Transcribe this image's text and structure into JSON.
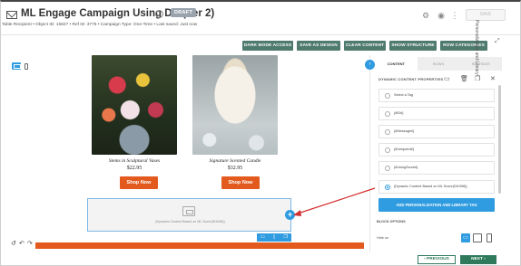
{
  "header": {
    "title": "ML Engage Campaign Using DC (Ver 2)",
    "status_badge": "DRAFT",
    "meta": "Table Recipient  •  Object ID: 15827  •  Ref ID: 3775  •  Campaign Type: One-Time  •  Last saved: Just now",
    "save_label": "SAVE",
    "icons": [
      "info-icon",
      "settings-icon",
      "preview-icon",
      "more-icon"
    ]
  },
  "toolbar": {
    "buttons": [
      "DARK MODE ACCESS",
      "SAVE AS DESIGN",
      "CLEAR CONTENT",
      "SHOW STRUCTURE",
      "ROW CATEGORIES"
    ]
  },
  "products": [
    {
      "name": "Stems in Sculptural Vases",
      "price": "$22.95",
      "button": "Shop Now"
    },
    {
      "name": "Signature Scented Candle",
      "price": "$32.95",
      "button": "Shop Now"
    }
  ],
  "placeholder": {
    "text": "{Dynamic Content Based on ML Score(Dt1098)}"
  },
  "panel": {
    "tabs": [
      "CONTENT",
      "ROWS",
      "SETTINGS"
    ],
    "section_title": "DYNAMIC CONTENT PROPERTIES",
    "options": [
      {
        "label": "Select a Tag",
        "selected": false
      },
      {
        "label": "{#ID#}",
        "selected": false
      },
      {
        "label": "{#Message#}",
        "selected": false
      },
      {
        "label": "{#UniqueId#}",
        "selected": false
      },
      {
        "label": "{#UsingScore#}",
        "selected": false
      },
      {
        "label": "{Dynamic Content Based on ML Score(Dt1098)}",
        "selected": true
      }
    ],
    "add_button": "ADD PERSONALIZATION AND LIBRARY TAG",
    "block_options": "BLOCK OPTIONS",
    "hide_on": "Hide on",
    "side_label": "Personalization and Library"
  },
  "footer": {
    "previous": "‹  PREVIOUS",
    "next": "NEXT  ›"
  },
  "colors": {
    "accent": "#2f9be0",
    "toolbar_green": "#4f7a6e",
    "shop_orange": "#e35a1f",
    "arrow_red": "#d32f2f",
    "footer_green": "#2f7a5c"
  }
}
